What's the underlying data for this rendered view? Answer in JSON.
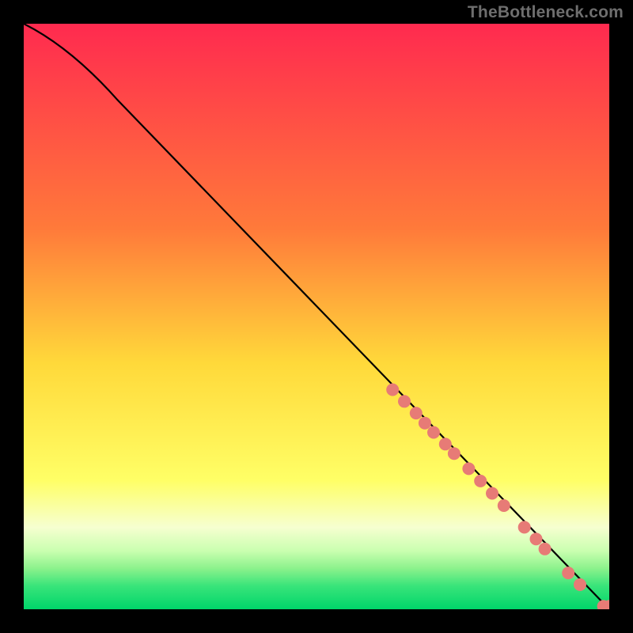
{
  "attribution": "TheBottleneck.com",
  "chart_data": {
    "type": "line",
    "title": "",
    "xlabel": "",
    "ylabel": "",
    "xlim": [
      0,
      100
    ],
    "ylim": [
      0,
      100
    ],
    "gradient_stops": [
      {
        "offset": 0,
        "color": "#ff2a4f"
      },
      {
        "offset": 35,
        "color": "#ff7a3a"
      },
      {
        "offset": 58,
        "color": "#ffd93a"
      },
      {
        "offset": 78,
        "color": "#ffff66"
      },
      {
        "offset": 86,
        "color": "#f6ffd0"
      },
      {
        "offset": 90,
        "color": "#caffb0"
      },
      {
        "offset": 93,
        "color": "#8cf28c"
      },
      {
        "offset": 96,
        "color": "#39e47a"
      },
      {
        "offset": 100,
        "color": "#00d66a"
      }
    ],
    "curve": [
      {
        "x": 0,
        "y": 100
      },
      {
        "x": 6,
        "y": 96
      },
      {
        "x": 12,
        "y": 91
      },
      {
        "x": 20,
        "y": 83
      },
      {
        "x": 30,
        "y": 72
      },
      {
        "x": 40,
        "y": 61.5
      },
      {
        "x": 50,
        "y": 51
      },
      {
        "x": 60,
        "y": 40.5
      },
      {
        "x": 70,
        "y": 30
      },
      {
        "x": 80,
        "y": 19.5
      },
      {
        "x": 90,
        "y": 9
      },
      {
        "x": 100,
        "y": 0
      }
    ],
    "markers": [
      {
        "x": 63,
        "y": 37.5
      },
      {
        "x": 65,
        "y": 35.5
      },
      {
        "x": 67,
        "y": 33.5
      },
      {
        "x": 68.5,
        "y": 31.8
      },
      {
        "x": 70,
        "y": 30.2
      },
      {
        "x": 72,
        "y": 28.2
      },
      {
        "x": 73.5,
        "y": 26.6
      },
      {
        "x": 76,
        "y": 24
      },
      {
        "x": 78,
        "y": 21.9
      },
      {
        "x": 80,
        "y": 19.8
      },
      {
        "x": 82,
        "y": 17.7
      },
      {
        "x": 85.5,
        "y": 14
      },
      {
        "x": 87.5,
        "y": 12
      },
      {
        "x": 89,
        "y": 10.3
      },
      {
        "x": 93,
        "y": 6.2
      },
      {
        "x": 95,
        "y": 4.2
      },
      {
        "x": 99,
        "y": 0.5
      },
      {
        "x": 100,
        "y": 0.5
      },
      {
        "x": 101,
        "y": 0.5
      }
    ],
    "marker_style": {
      "fill": "#e77b76",
      "radius_px": 8
    }
  }
}
